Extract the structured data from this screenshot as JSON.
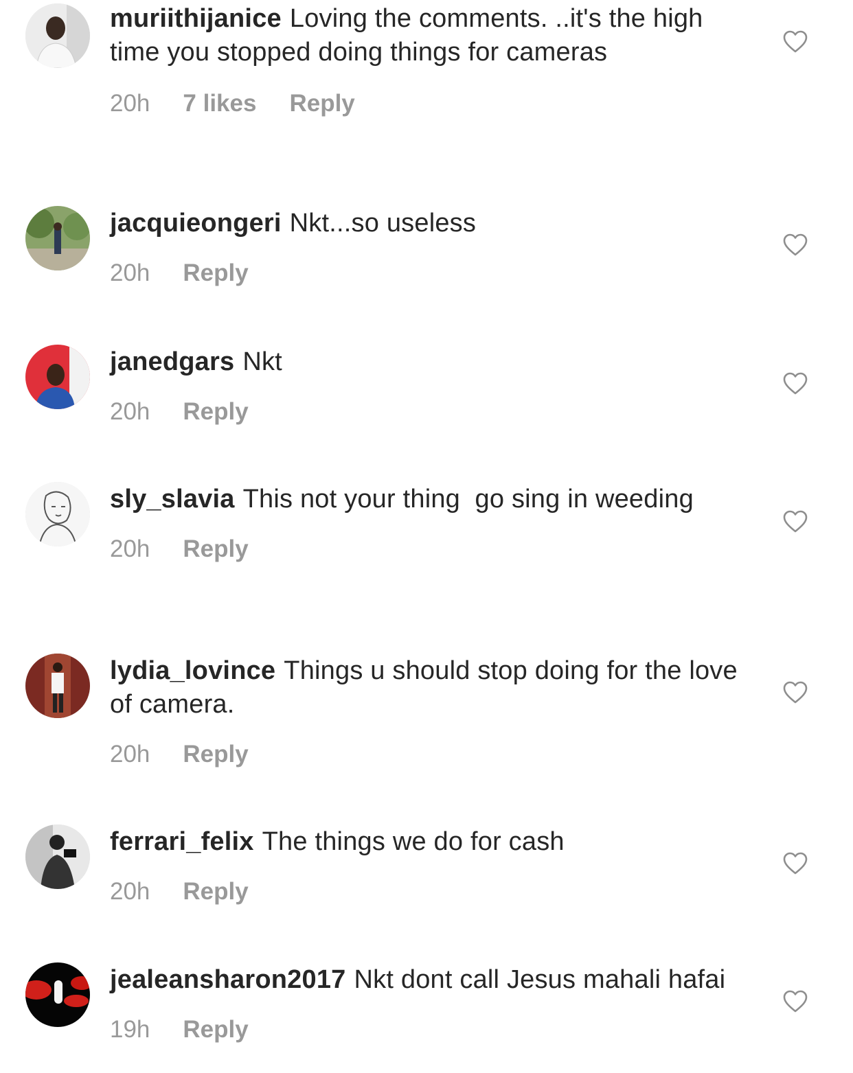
{
  "colors": {
    "text": "#262626",
    "meta": "#999999",
    "heart": "#8e8e8e"
  },
  "comments": [
    {
      "username": "muriithijanice",
      "text": "Loving the comments. ..it's the high time you stopped doing things for cameras",
      "time": "20h",
      "likes": "7 likes",
      "reply": "Reply",
      "avatar_icon": "avatar-photo"
    },
    {
      "username": "jacquieongeri",
      "text": "Nkt...so useless",
      "time": "20h",
      "reply": "Reply",
      "avatar_icon": "avatar-photo"
    },
    {
      "username": "janedgars",
      "text": "Nkt",
      "time": "20h",
      "reply": "Reply",
      "avatar_icon": "avatar-photo"
    },
    {
      "username": "sly_slavia",
      "text": "This not your thing  go sing in weeding",
      "time": "20h",
      "reply": "Reply",
      "avatar_icon": "avatar-photo"
    },
    {
      "username": "lydia_lovince",
      "text": "Things u should stop doing for the love of camera.",
      "time": "20h",
      "reply": "Reply",
      "avatar_icon": "avatar-photo"
    },
    {
      "username": "ferrari_felix",
      "text": "The things we do for cash",
      "time": "20h",
      "reply": "Reply",
      "avatar_icon": "avatar-photo"
    },
    {
      "username": "jealeansharon2017",
      "text": "Nkt dont call Jesus mahali hafai",
      "time": "19h",
      "reply": "Reply",
      "avatar_icon": "avatar-photo"
    }
  ]
}
